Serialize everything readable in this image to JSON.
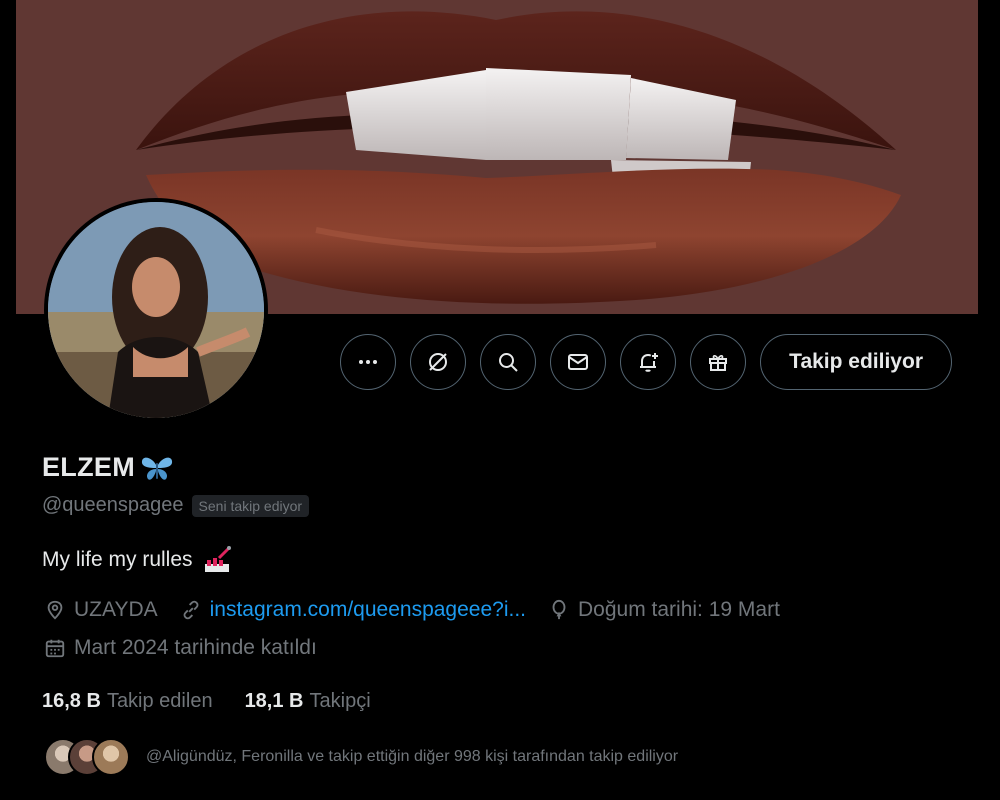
{
  "profile": {
    "display_name": "ELZEM",
    "name_emoji": "butterfly",
    "handle": "@queenspagee",
    "follows_you_badge": "Seni takip ediyor",
    "bio": "My life my rulles",
    "bio_emoji": "lipstick",
    "location": "UZAYDA",
    "website": "instagram.com/queenspageee?i...",
    "birthday": "Doğum tarihi: 19 Mart",
    "joined": "Mart 2024 tarihinde katıldı",
    "following_count": "16,8 B",
    "following_label": "Takip edilen",
    "followers_count": "18,1 B",
    "followers_label": "Takipçi",
    "followed_by_text": "@Aligündüz, Feronilla ve takip ettiğin diğer 998 kişi tarafından takip ediliyor"
  },
  "actions": {
    "more_icon": "more-icon",
    "grok_icon": "grok-icon",
    "search_icon": "search-icon",
    "message_icon": "mail-icon",
    "notify_icon": "bell-plus-icon",
    "gift_icon": "gift-icon",
    "follow_label": "Takip ediliyor"
  },
  "colors": {
    "background": "#000000",
    "text_primary": "#e7e9ea",
    "text_secondary": "#71767b",
    "link": "#1d9bf0",
    "border": "#536471"
  }
}
